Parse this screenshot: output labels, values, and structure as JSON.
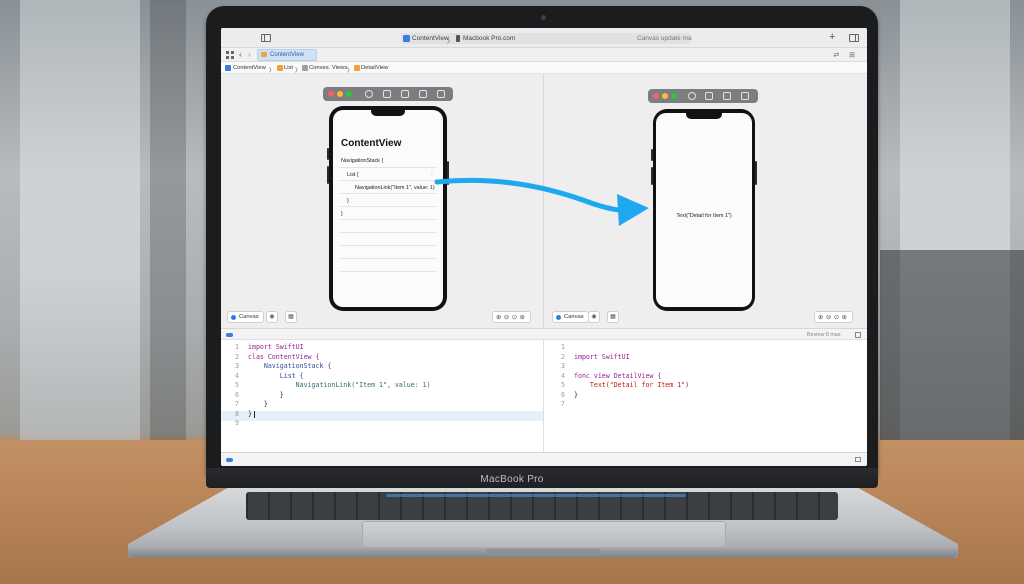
{
  "window": {
    "crumb_app": "ContentView",
    "crumb_separator": "〉",
    "crumb_device": "Macbook Pro.com",
    "status": "Canvas update ma",
    "add_tab": "+"
  },
  "tabbar": {
    "back": "‹",
    "forward": "›",
    "active_tab": "ContentView",
    "right_icons": "⇄ ⊞"
  },
  "jumpbar": {
    "items": [
      "ContentView",
      "List",
      "Conves. Views",
      "DetailView"
    ],
    "separator": "〉"
  },
  "left_preview": {
    "title": "ContentView",
    "lines": [
      "NavigationStack {",
      "List {",
      "NavigationLink(\"Item 1\", value: 1)",
      "}",
      "}"
    ],
    "chevron": "›"
  },
  "right_preview": {
    "text": "Text(\"Detail for Item 1\")"
  },
  "canvas_controls": {
    "canvas_label": "Canvas",
    "live_icon": "◉",
    "device_icon": "▦",
    "zoom_icons": "⊕⊖⊙⊕"
  },
  "code_header": {
    "status": "Beview 8 mas"
  },
  "left_code": {
    "line_numbers": [
      "1",
      "2",
      "3",
      "4",
      "5",
      "6",
      "7",
      "8",
      "9"
    ],
    "lines": [
      "import SwiftUI",
      "clas ContentView {",
      "    NavigationStack {",
      "        List {",
      "            NavigationLink(\"Item 1\", value: 1)",
      "        }",
      "    }",
      "}",
      ""
    ]
  },
  "right_code": {
    "line_numbers": [
      "1",
      "2",
      "3",
      "4",
      "5",
      "6",
      "7"
    ],
    "lines": [
      "",
      "import SwiftUI",
      "",
      "fonc view DetailView {",
      "    Text(\"Detail for Item 1\")",
      "}",
      ""
    ]
  },
  "laptop": {
    "model_label": "MacBook Pro"
  },
  "colors": {
    "accent": "#3b7ddd",
    "arrow": "#1ea8f0",
    "traffic_red": "#ff5f57",
    "traffic_yellow": "#febc2e",
    "traffic_green": "#28c840"
  }
}
